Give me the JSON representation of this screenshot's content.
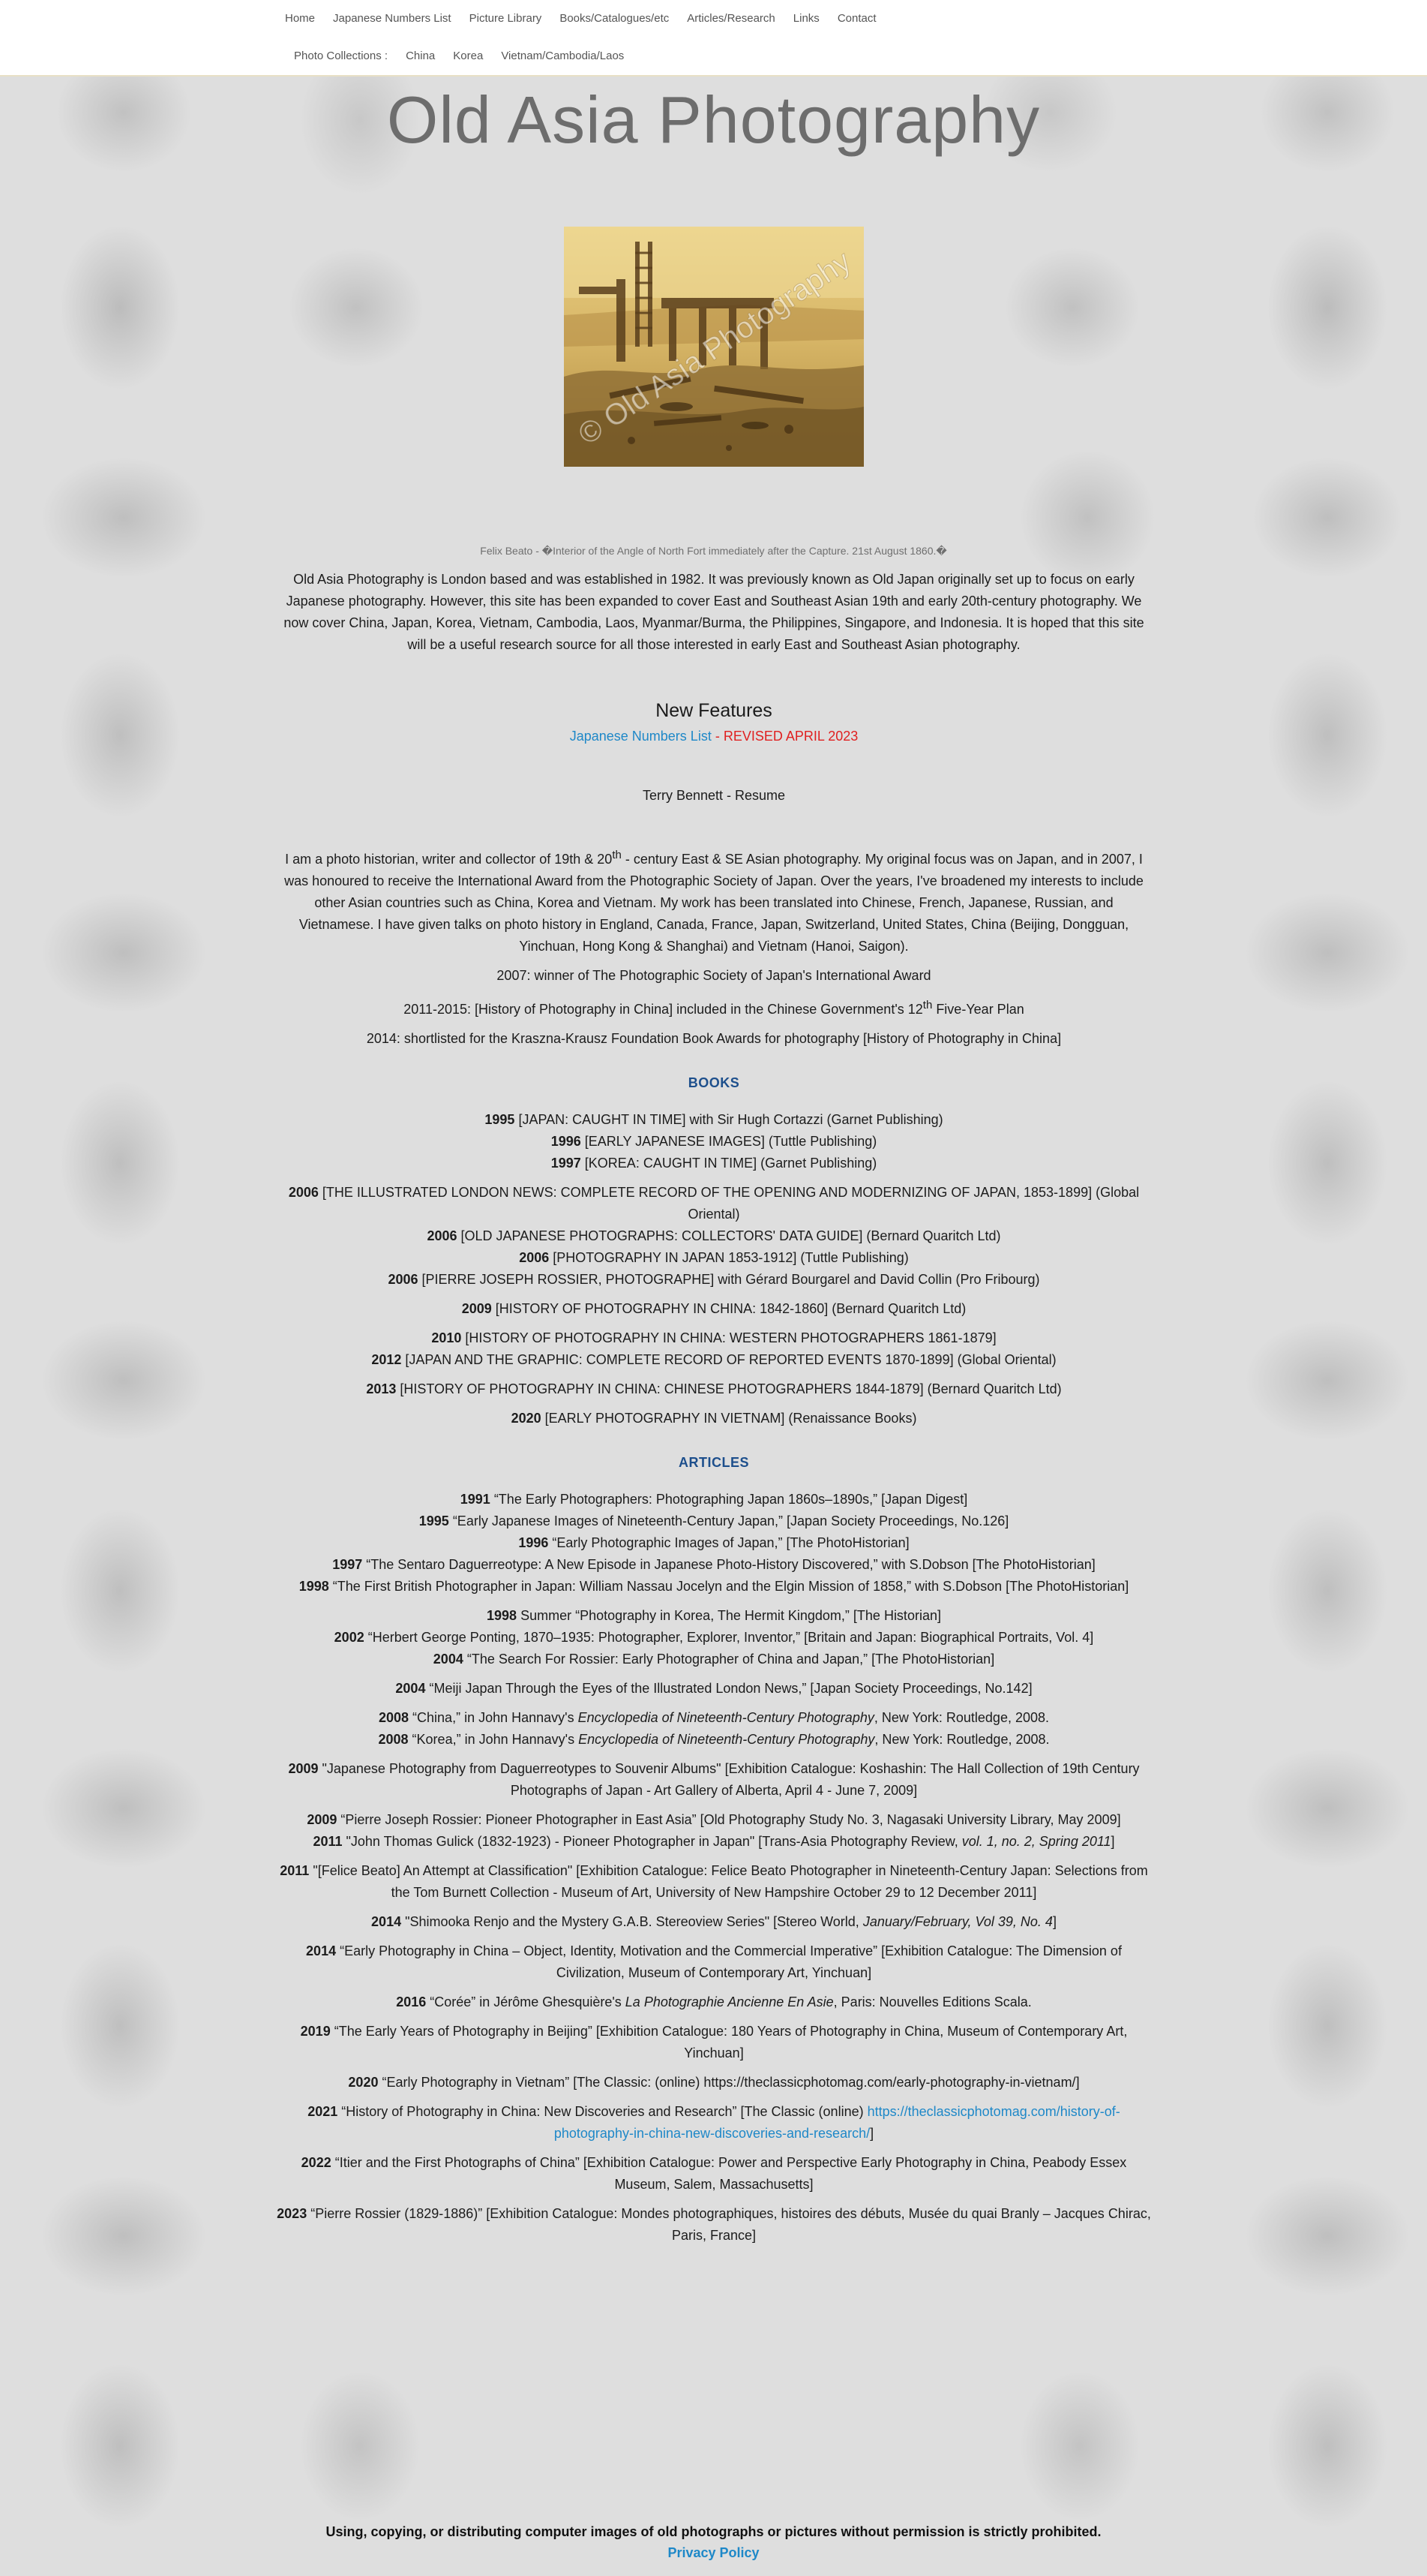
{
  "nav": {
    "primary": [
      "Home",
      "Japanese Numbers List",
      "Picture Library",
      "Books/Catalogues/etc",
      "Articles/Research",
      "Links",
      "Contact"
    ],
    "secondary": [
      "Photo Collections :",
      "China",
      "Korea",
      "Vietnam/Cambodia/Laos"
    ]
  },
  "site_title": "Old Asia Photography",
  "hero": {
    "watermark": "© Old Asia Photography",
    "caption": "Felix Beato - �Interior of the Angle of North Fort immediately after the Capture. 21st August 1860.�"
  },
  "intro": "Old Asia Photography is London based and was established in 1982. It was previously known as Old Japan originally set up to focus on early Japanese photography. However, this site has been expanded to cover East and Southeast Asian 19th and early 20th-century photography. We now cover China, Japan, Korea, Vietnam, Cambodia, Laos, Myanmar/Burma, the Philippines, Singapore, and Indonesia. It is hoped that this site will be a useful research source for all those interested in early East and Southeast Asian photography.",
  "features": {
    "heading": "New Features",
    "link": "Japanese Numbers List",
    "sep": " - ",
    "note": "REVISED APRIL 2023"
  },
  "resume_heading": "Terry Bennett - Resume",
  "bio": {
    "a": "I am a photo historian, writer and collector of 19th & 20",
    "sup": "th",
    "b": " - century East & SE Asian photography. My original focus was on Japan, and in 2007, I was honoured to receive the International Award from the Photographic Society of Japan.  Over the years, I've broadened my interests to include other Asian countries such as China, Korea and Vietnam. My work has been translated into Chinese, French, Japanese, Russian, and Vietnamese. I have given talks on photo history in England, Canada, France, Japan, Switzerland, United States, China (Beijing, Dongguan, Yinchuan, Hong Kong & Shanghai) and Vietnam (Hanoi, Saigon)."
  },
  "awards": {
    "a1": "2007: winner of The Photographic Society of Japan's International Award",
    "a2_pre": "2011-2015: [History of Photography in China] included in the Chinese Government's 12",
    "a2_sup": "th",
    "a2_post": " Five-Year Plan",
    "a3": "2014: shortlisted for the Kraszna-Krausz Foundation Book Awards for photography [History of Photography in China]"
  },
  "books": {
    "heading": "BOOKS",
    "items": [
      {
        "year": "1995",
        "text": " [JAPAN: CAUGHT IN TIME] with Sir Hugh Cortazzi (Garnet Publishing)"
      },
      {
        "year": "1996",
        "text": " [EARLY JAPANESE IMAGES] (Tuttle Publishing)"
      },
      {
        "year": "1997",
        "text": " [KOREA: CAUGHT IN TIME] (Garnet Publishing)"
      },
      {
        "year": "2006",
        "text": " [THE ILLUSTRATED LONDON NEWS: COMPLETE RECORD OF THE OPENING AND MODERNIZING OF JAPAN, 1853-1899] (Global Oriental)"
      },
      {
        "year": "2006",
        "text": " [OLD JAPANESE PHOTOGRAPHS: COLLECTORS' DATA GUIDE] (Bernard Quaritch Ltd)"
      },
      {
        "year": "2006",
        "text": " [PHOTOGRAPHY IN JAPAN 1853-1912] (Tuttle Publishing)"
      },
      {
        "year": "2006",
        "text": " [PIERRE JOSEPH ROSSIER, PHOTOGRAPHE] with Gérard Bourgarel and David Collin (Pro Fribourg)"
      },
      {
        "year": "2009",
        "text": " [HISTORY OF PHOTOGRAPHY IN CHINA: 1842-1860] (Bernard Quaritch Ltd)"
      },
      {
        "year": "2010",
        "text": " [HISTORY OF PHOTOGRAPHY IN CHINA: WESTERN PHOTOGRAPHERS 1861-1879]"
      },
      {
        "year": "2012",
        "text": " [JAPAN AND THE GRAPHIC: COMPLETE RECORD OF REPORTED EVENTS 1870-1899] (Global Oriental)"
      },
      {
        "year": "2013",
        "text": " [HISTORY OF PHOTOGRAPHY IN CHINA: CHINESE PHOTOGRAPHERS 1844-1879] (Bernard Quaritch Ltd)"
      },
      {
        "year": "2020",
        "text": " [EARLY PHOTOGRAPHY IN VIETNAM] (Renaissance Books)"
      }
    ]
  },
  "articles": {
    "heading": "ARTICLES",
    "items": [
      {
        "year": "1991",
        "text": " “The Early Photographers: Photographing Japan 1860s–1890s,” [Japan Digest]"
      },
      {
        "year": "1995",
        "text": " “Early Japanese Images of Nineteenth-Century Japan,” [Japan Society Proceedings, No.126]"
      },
      {
        "year": "1996",
        "text": " “Early Photographic Images of Japan,” [The PhotoHistorian]"
      },
      {
        "year": "1997",
        "text": " “The Sentaro Daguerreotype: A New Episode in Japanese Photo-History Discovered,” with S.Dobson [The PhotoHistorian]"
      },
      {
        "year": "1998",
        "text": " “The First British Photographer in Japan: William Nassau Jocelyn and the Elgin Mission of 1858,” with S.Dobson [The PhotoHistorian]"
      },
      {
        "year": "1998",
        "text": " Summer “Photography in Korea, The Hermit Kingdom,” [The Historian]"
      },
      {
        "year": "2002",
        "text": " “Herbert George Ponting, 1870–1935: Photographer, Explorer, Inventor,” [Britain and Japan: Biographical Portraits, Vol. 4]"
      },
      {
        "year": "2004",
        "text": " “The Search For Rossier: Early Photographer of China and Japan,” [The PhotoHistorian]"
      },
      {
        "year": "2004",
        "text": " “Meiji Japan Through the Eyes of the Illustrated London News,” [Japan Society Proceedings, No.142]"
      },
      {
        "year": "2008",
        "text": " “China,” in John Hannavy's ",
        "ital": "Encyclopedia of Nineteenth-Century Photography",
        "post": ", New York: Routledge, 2008."
      },
      {
        "year": "2008",
        "text": " “Korea,” in John Hannavy's ",
        "ital": "Encyclopedia of Nineteenth-Century Photography",
        "post": ", New York: Routledge, 2008."
      },
      {
        "year": "2009",
        "text": " \"Japanese Photography from Daguerreotypes to Souvenir Albums\" [Exhibition Catalogue: Koshashin: The Hall Collection of 19th Century Photographs of Japan - Art Gallery of Alberta, April 4 - June 7, 2009]"
      },
      {
        "year": "2009",
        "text": " “Pierre Joseph Rossier: Pioneer Photographer in East Asia” [Old Photography Study No. 3, Nagasaki University Library, May 2009]"
      },
      {
        "year": "2011",
        "text": " \"John Thomas Gulick (1832-1923) - Pioneer Photographer in Japan\" [Trans-Asia Photography Review, ",
        "ital": "vol. 1, no. 2, Spring 2011",
        "post": "]"
      },
      {
        "year": "2011",
        "text": " \"[Felice Beato] An Attempt at Classification\" [Exhibition Catalogue: Felice Beato Photographer in Nineteenth-Century Japan: Selections from the Tom Burnett Collection - Museum of Art, University of New Hampshire October 29 to 12 December 2011]"
      },
      {
        "year": "2014",
        "text": " \"Shimooka Renjo and the Mystery G.A.B. Stereoview Series\" [Stereo World, ",
        "ital": "January/February, Vol 39, No. 4",
        "post": "]"
      },
      {
        "year": "2014",
        "text": " “Early Photography in China – Object, Identity, Motivation and the Commercial Imperative” [Exhibition Catalogue: The Dimension of Civilization, Museum of Contemporary Art, Yinchuan]"
      },
      {
        "year": "2016",
        "text": " “Corée” in Jérôme Ghesquière's  ",
        "ital": "La Photographie Ancienne En Asie",
        "post": ", Paris: Nouvelles Editions Scala."
      },
      {
        "year": "2019",
        "text": " “The Early Years of Photography in Beijing” [Exhibition Catalogue: 180 Years of Photography in China, Museum of Contemporary Art, Yinchuan]"
      },
      {
        "year": "2020",
        "text": " “Early Photography in Vietnam” [The Classic: (online) https://theclassicphotomag.com/early-photography-in-vietnam/]"
      },
      {
        "year": "2021",
        "text": " “History of Photography in China: New Discoveries and Research” [The Classic (online)  ",
        "link": "https://theclassicphotomag.com/history-of-photography-in-china-new-discoveries-and-research/",
        "post": "]"
      },
      {
        "year": "2022",
        "text": "  “Itier and the First Photographs of China” [Exhibition Catalogue: Power and Perspective Early Photography in China, Peabody Essex Museum, Salem, Massachusetts]"
      },
      {
        "year": "2023",
        "text": " “Pierre Rossier (1829-1886)” [Exhibition Catalogue: Mondes photographiques, histoires des débuts, Musée du quai Branly – Jacques Chirac, Paris, France]"
      }
    ]
  },
  "footer": {
    "notice": "Using, copying, or distributing computer images of old photographs or pictures without permission is strictly prohibited.",
    "privacy": "Privacy Policy"
  },
  "colors": {
    "link": "#1e88c8",
    "heading_blue": "#1d4f8c",
    "revised_red": "#e02020",
    "background": "#dedede"
  }
}
